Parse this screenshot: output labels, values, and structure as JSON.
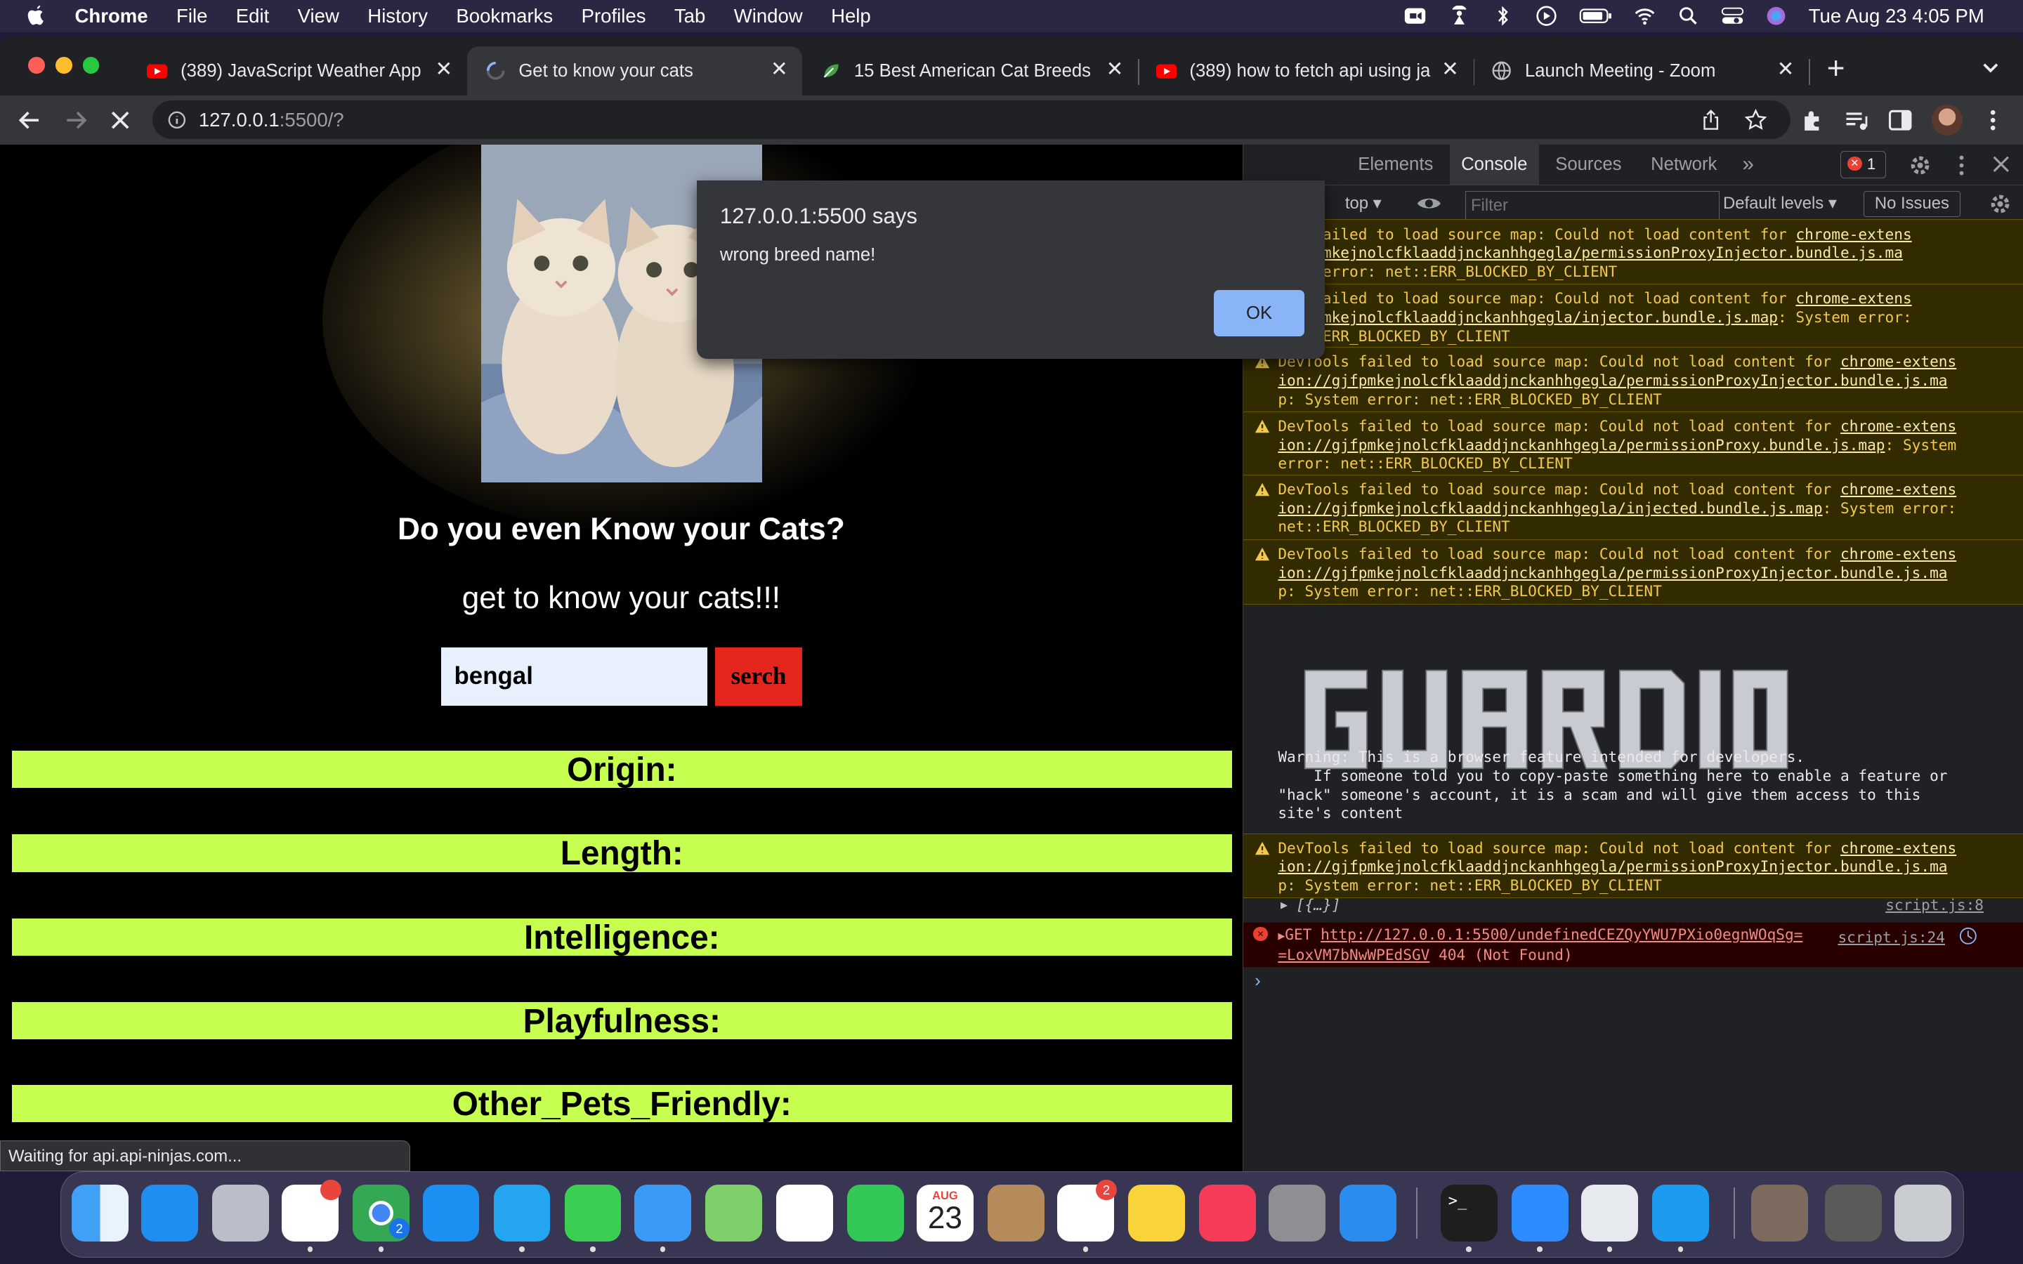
{
  "menubar": {
    "app": "Chrome",
    "items": [
      "File",
      "Edit",
      "View",
      "History",
      "Bookmarks",
      "Profiles",
      "Tab",
      "Window",
      "Help"
    ],
    "clock": "Tue Aug 23  4:05 PM"
  },
  "tabs": [
    {
      "title": "(389) JavaScript Weather App",
      "icon": "youtube-icon"
    },
    {
      "title": "Get to know your cats",
      "icon": "loading-spinner-icon"
    },
    {
      "title": "15 Best American Cat Breeds -",
      "icon": "leaf-icon"
    },
    {
      "title": "(389) how to fetch api using ja",
      "icon": "youtube-icon"
    },
    {
      "title": "Launch Meeting - Zoom",
      "icon": "globe-icon"
    }
  ],
  "address": {
    "host": "127.0.0.1",
    "rest": ":5500/?"
  },
  "page": {
    "heading": "Do you even Know your Cats?",
    "subheading": "get to know your cats!!!",
    "search_value": "bengal",
    "search_button": "serch",
    "fields": [
      "Origin:",
      "Length:",
      "Intelligence:",
      "Playfulness:",
      "Other_Pets_Friendly:"
    ],
    "status": "Waiting for api.api-ninjas.com..."
  },
  "dialog": {
    "title": "127.0.0.1:5500 says",
    "message": "wrong breed name!",
    "ok": "OK"
  },
  "devtools": {
    "tabs": [
      "Elements",
      "Console",
      "Sources",
      "Network"
    ],
    "active_tab": "Console",
    "error_count": "1",
    "context": "top",
    "filter_placeholder": "Filter",
    "levels": "Default levels",
    "issues": "No Issues",
    "warnings": [
      {
        "pre": "ols failed to load source map: Could not load content for ",
        "link": "chrome-extens",
        "l2link": "/gjfpmkejnolcfklaaddjnckanhhgegla/permissionProxyInjector.bundle.js.ma",
        "l2rest": "",
        "l3": "stem error: net::ERR_BLOCKED_BY_CLIENT"
      },
      {
        "pre": "ols failed to load source map: Could not load content for ",
        "link": "chrome-extens",
        "l2link": "/gjfpmkejnolcfklaaddjnckanhhgegla/injector.bundle.js.map",
        "l2rest": ": System error:",
        "l3": "net::ERR_BLOCKED_BY_CLIENT"
      },
      {
        "pre": "DevTools failed to load source map: Could not load content for ",
        "link": "chrome-extens",
        "l2link": "ion://gjfpmkejnolcfklaaddjnckanhhgegla/permissionProxyInjector.bundle.js.ma",
        "l2rest": "",
        "l3": "p: System error: net::ERR_BLOCKED_BY_CLIENT"
      },
      {
        "pre": "DevTools failed to load source map: Could not load content for ",
        "link": "chrome-extens",
        "l2link": "ion://gjfpmkejnolcfklaaddjnckanhhgegla/permissionProxy.bundle.js.map",
        "l2rest": ": System",
        "l3": "error: net::ERR_BLOCKED_BY_CLIENT"
      },
      {
        "pre": "DevTools failed to load source map: Could not load content for ",
        "link": "chrome-extens",
        "l2link": "ion://gjfpmkejnolcfklaaddjnckanhhgegla/injected.bundle.js.map",
        "l2rest": ": System error:",
        "l3": "net::ERR_BLOCKED_BY_CLIENT"
      },
      {
        "pre": "DevTools failed to load source map: Could not load content for ",
        "link": "chrome-extens",
        "l2link": "ion://gjfpmkejnolcfklaaddjnckanhhgegla/permissionProxyInjector.bundle.js.ma",
        "l2rest": "",
        "l3": "p: System error: net::ERR_BLOCKED_BY_CLIENT"
      }
    ],
    "guardio_text": "GUARDIO",
    "console_warning": "Warning: This is a browser feature intended for developers.\n    If someone told you to copy-paste something here to enable a feature or\n\"hack\" someone's account, it is a scam and will give them access to this\nsite's content",
    "warning_last": {
      "pre": "DevTools failed to load source map: Could not load content for ",
      "link": "chrome-extens",
      "l2link": "ion://gjfpmkejnolcfklaaddjnckanhhgegla/permissionProxyInjector.bundle.js.ma",
      "l3": "p: System error: net::ERR_BLOCKED_BY_CLIENT"
    },
    "log_obj": "[{…}]",
    "log_obj_src": "script.js:8",
    "error": {
      "method": "GET",
      "url1": "http://127.0.0.1:5500/undefinedCEZQyYWU7PXio0egnWOqSg=",
      "url2": "=LoxVM7bNwWPEdSGV",
      "status": "404 (Not Found)",
      "src": "script.js:24"
    }
  },
  "dock": {
    "apps": [
      "finder-icon",
      "app-store-icon",
      "launchpad-icon",
      "slack-icon",
      "chrome-icon",
      "safari-icon",
      "vscode-icon",
      "messages-icon",
      "mail-icon",
      "maps-icon",
      "photos-icon",
      "facetime-icon",
      "calendar-icon",
      "contacts-icon",
      "reminders-icon",
      "notes-icon",
      "music-icon",
      "system-preferences-icon",
      "keynote-icon",
      "terminal-icon",
      "zoom-icon",
      "preview-icon",
      "twitter-icon",
      "screenshot-thumb-1",
      "screenshot-thumb-2",
      "trash-icon"
    ],
    "calendar_month": "AUG",
    "calendar_day": "23",
    "slack_badge": "",
    "chrome_badge": "2",
    "reminders_badge": "2"
  },
  "colors": {
    "accent_bar": "#c6ff50",
    "search_button": "#e5261d",
    "ok_button": "#8ab4f8"
  }
}
